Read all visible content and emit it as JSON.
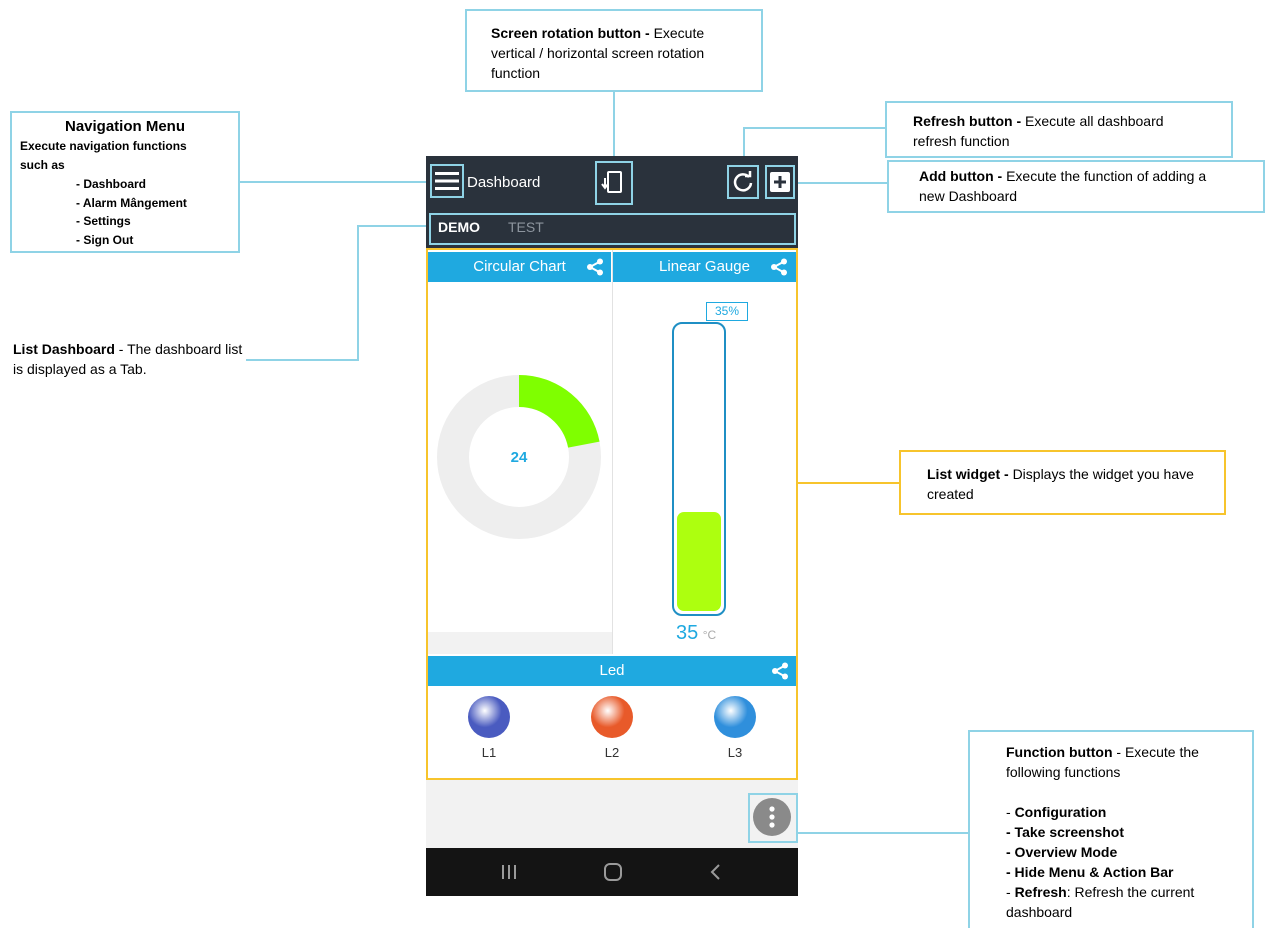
{
  "callouts": {
    "navigation": {
      "title": "Navigation Menu",
      "lead": "Execute navigation functions such as",
      "items": [
        "- Dashboard",
        "- Alarm Mângement",
        "- Settings",
        "- Sign Out"
      ]
    },
    "rotation": {
      "bold": "Screen rotation button - ",
      "text": "Execute vertical / horizontal screen rotation function"
    },
    "refresh": {
      "bold": "Refresh button - ",
      "text": "Execute all dashboard refresh function"
    },
    "add": {
      "bold": "Add button - ",
      "text": "Execute the function of adding a new Dashboard"
    },
    "list_dashboard": {
      "bold": "List Dashboard",
      "text": " - The dashboard list is displayed as a Tab."
    },
    "list_widget": {
      "bold": "List widget - ",
      "text": "Displays the widget you have created"
    },
    "function": {
      "bold": "Function button",
      "text": " - Execute the following functions",
      "items": [
        {
          "bold": "Configuration",
          "prefix": "- ",
          "suffix": ""
        },
        {
          "bold": "- Take screenshot",
          "prefix": "",
          "suffix": ""
        },
        {
          "bold": "- Overview Mode",
          "prefix": "",
          "suffix": ""
        },
        {
          "bold": "- Hide Menu & Action Bar",
          "prefix": "",
          "suffix": ""
        },
        {
          "bold": "Refresh",
          "prefix": "- ",
          "suffix": ": Refresh the current dashboard"
        }
      ]
    }
  },
  "app": {
    "title": "Dashboard",
    "tabs": [
      {
        "label": "DEMO",
        "active": true
      },
      {
        "label": "TEST",
        "active": false
      }
    ],
    "widgets": {
      "circular": {
        "title": "Circular Chart",
        "value": "24",
        "fraction": 0.22,
        "color": "#7fff00"
      },
      "gauge": {
        "title": "Linear Gauge",
        "percent_label": "35%",
        "value": "35",
        "unit": "°C",
        "fill_fraction": 0.35,
        "color": "#adff0f"
      },
      "led": {
        "title": "Led",
        "items": [
          {
            "label": "L1",
            "color": "#4a5bc0"
          },
          {
            "label": "L2",
            "color": "#e85a2a"
          },
          {
            "label": "L3",
            "color": "#2f8fdc"
          }
        ]
      }
    },
    "accent": "#1fa9e0",
    "appbar_color": "#2a323c"
  }
}
